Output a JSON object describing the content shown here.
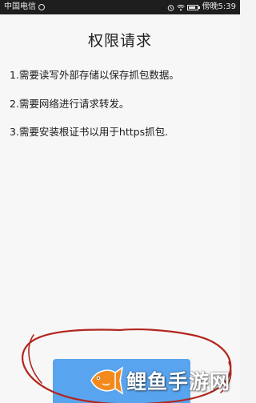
{
  "status_bar": {
    "carrier": "中国电信",
    "time_text": "傍晚5:39",
    "icons": [
      "alarm-icon",
      "wifi-icon",
      "battery-icon"
    ]
  },
  "dialog": {
    "title": "权限请求",
    "permissions": [
      "1.需要读写外部存储以保存抓包数据。",
      "2.需要网络进行请求转发。",
      "3.需要安装根证书以用于https抓包."
    ]
  },
  "watermark": {
    "text": "鲤鱼手游网",
    "icon": "fish-logo"
  },
  "colors": {
    "status_bar_bg": "#1e1e1e",
    "background": "#f7f7f7",
    "button_blue": "#58a4ee",
    "annotation_red": "#b3261e",
    "fish_orange": "#f28a1d"
  }
}
